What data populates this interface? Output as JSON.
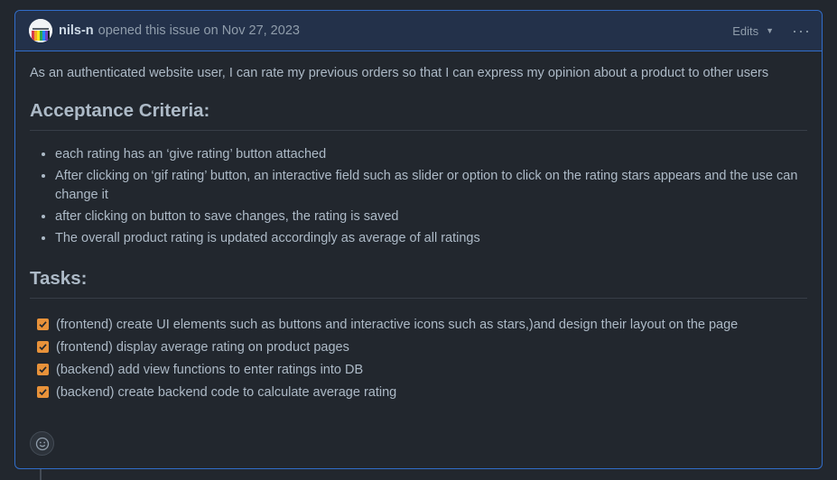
{
  "header": {
    "author": "nils-n",
    "action": "opened this issue on",
    "date": "Nov 27, 2023",
    "edits_label": "Edits",
    "more_label": "···"
  },
  "body": {
    "intro": "As an authenticated website user, I can rate my previous orders so that I can express my opinion about a product to other users",
    "acceptance_heading": "Acceptance Criteria:",
    "acceptance_items": [
      "each rating has an ‘give rating’ button attached",
      "After clicking on ‘gif rating’ button, an interactive field such as slider or option to click on the rating stars appears and the use can change it",
      "after clicking on button to save changes, the rating is saved",
      "The overall product rating is updated accordingly as average of all ratings"
    ],
    "tasks_heading": "Tasks:",
    "tasks": [
      {
        "label": "(frontend) create UI elements such as buttons and interactive icons such as stars,)and design their layout on the page",
        "checked": true
      },
      {
        "label": "(frontend) display average rating on product pages",
        "checked": true
      },
      {
        "label": "(backend) add view functions to enter ratings into DB",
        "checked": true
      },
      {
        "label": "(backend) create backend code to calculate average rating",
        "checked": true
      }
    ]
  },
  "colors": {
    "accent": "#316dca",
    "checkbox": "#e8923a",
    "background": "#22272e"
  },
  "icons": {
    "edits_caret": "caret-down-icon",
    "more": "kebab-horizontal-icon",
    "reaction": "smiley-icon",
    "checkmark": "check-icon"
  }
}
